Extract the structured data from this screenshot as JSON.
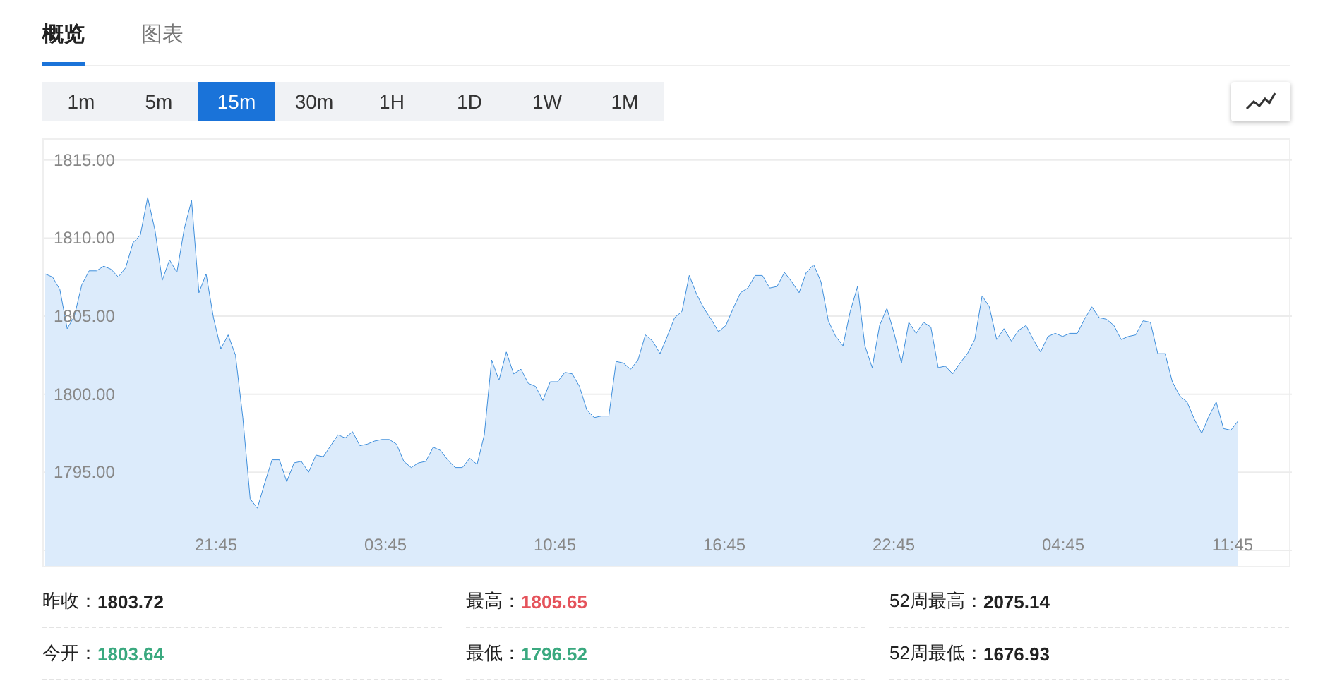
{
  "tabs": [
    {
      "label": "概览",
      "selected": true
    },
    {
      "label": "图表",
      "selected": false
    }
  ],
  "periods": [
    {
      "label": "1m",
      "selected": false
    },
    {
      "label": "5m",
      "selected": false
    },
    {
      "label": "15m",
      "selected": true
    },
    {
      "label": "30m",
      "selected": false
    },
    {
      "label": "1H",
      "selected": false
    },
    {
      "label": "1D",
      "selected": false
    },
    {
      "label": "1W",
      "selected": false
    },
    {
      "label": "1M",
      "selected": false
    }
  ],
  "chart": {
    "time_labels": [
      "21:45",
      "03:45",
      "10:45",
      "16:45",
      "22:45",
      "04:45",
      "11:45"
    ],
    "chart_data": {
      "type": "area",
      "grid": true,
      "ylim": [
        1789,
        1816.3
      ],
      "yticks": [
        {
          "value": 1795,
          "label": "1795.00"
        },
        {
          "value": 1800,
          "label": "1800.00"
        },
        {
          "value": 1805,
          "label": "1805.00"
        },
        {
          "value": 1810,
          "label": "1810.00"
        },
        {
          "value": 1815,
          "label": "1815.00"
        }
      ],
      "series": [
        {
          "color": "#3f8fdc",
          "values": [
            1807.7,
            1807.5,
            1806.7,
            1804.2,
            1805.0,
            1807.0,
            1807.9,
            1807.9,
            1808.2,
            1808.0,
            1807.5,
            1808.1,
            1809.7,
            1810.2,
            1812.6,
            1810.5,
            1807.3,
            1808.6,
            1807.8,
            1810.6,
            1812.4,
            1806.5,
            1807.7,
            1804.9,
            1802.9,
            1803.8,
            1802.5,
            1798.5,
            1793.3,
            1792.7,
            1794.3,
            1795.8,
            1795.8,
            1794.4,
            1795.6,
            1795.7,
            1795.0,
            1796.1,
            1796.0,
            1796.7,
            1797.4,
            1797.2,
            1797.6,
            1796.7,
            1796.8,
            1797.0,
            1797.1,
            1797.1,
            1796.8,
            1795.7,
            1795.3,
            1795.6,
            1795.7,
            1796.6,
            1796.4,
            1795.8,
            1795.3,
            1795.3,
            1795.9,
            1795.5,
            1797.4,
            1802.2,
            1800.9,
            1802.7,
            1801.3,
            1801.6,
            1800.7,
            1800.5,
            1799.6,
            1800.8,
            1800.8,
            1801.4,
            1801.3,
            1800.5,
            1799.0,
            1798.5,
            1798.6,
            1798.6,
            1802.1,
            1802.0,
            1801.6,
            1802.2,
            1803.8,
            1803.4,
            1802.6,
            1803.7,
            1804.9,
            1805.3,
            1807.6,
            1806.4,
            1805.5,
            1804.8,
            1804.0,
            1804.4,
            1805.5,
            1806.5,
            1806.8,
            1807.6,
            1807.6,
            1806.8,
            1806.9,
            1807.8,
            1807.2,
            1806.5,
            1807.8,
            1808.3,
            1807.2,
            1804.7,
            1803.7,
            1803.1,
            1805.3,
            1806.9,
            1803.1,
            1801.7,
            1804.4,
            1805.5,
            1803.9,
            1802.0,
            1804.6,
            1803.9,
            1804.6,
            1804.3,
            1801.7,
            1801.8,
            1801.3,
            1802.0,
            1802.6,
            1803.5,
            1806.3,
            1805.6,
            1803.5,
            1804.2,
            1803.4,
            1804.1,
            1804.4,
            1803.5,
            1802.7,
            1803.7,
            1803.9,
            1803.7,
            1803.9,
            1803.9,
            1804.8,
            1805.6,
            1804.9,
            1804.8,
            1804.4,
            1803.5,
            1803.7,
            1803.8,
            1804.7,
            1804.6,
            1802.6,
            1802.6,
            1800.8,
            1799.9,
            1799.5,
            1798.4,
            1797.5,
            1798.6,
            1799.5,
            1797.8,
            1797.7,
            1798.3
          ]
        }
      ]
    }
  },
  "stats": [
    {
      "label": "昨收：",
      "value": "1803.72",
      "color": "#222222"
    },
    {
      "label": "最高：",
      "value": "1805.65",
      "color": "#e5535b"
    },
    {
      "label": "52周最高：",
      "value": "2075.14",
      "color": "#222222"
    },
    {
      "label": "今开：",
      "value": "1803.64",
      "color": "#3aa97f"
    },
    {
      "label": "最低：",
      "value": "1796.52",
      "color": "#3aa97f"
    },
    {
      "label": "52周最低：",
      "value": "1676.93",
      "color": "#222222"
    }
  ]
}
